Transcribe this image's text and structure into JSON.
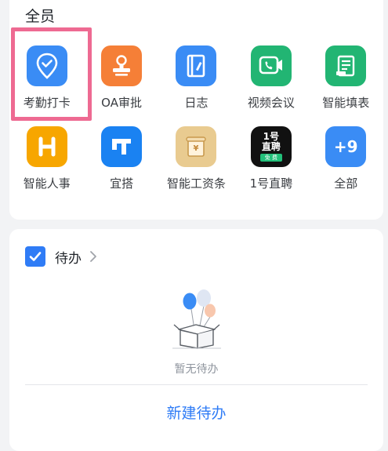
{
  "apps": {
    "section_title": "全员",
    "items": [
      {
        "label": "考勤打卡",
        "icon": "location-check-icon",
        "color": "#3a8cf5"
      },
      {
        "label": "OA审批",
        "icon": "stamp-icon",
        "color": "#f57f37"
      },
      {
        "label": "日志",
        "icon": "journal-pen-icon",
        "color": "#3a8cf5"
      },
      {
        "label": "视频会议",
        "icon": "video-call-icon",
        "color": "#22b573"
      },
      {
        "label": "智能填表",
        "icon": "form-icon",
        "color": "#22b573"
      },
      {
        "label": "智能人事",
        "icon": "hr-h-icon",
        "color": "#f7a600"
      },
      {
        "label": "宜搭",
        "icon": "yida-icon",
        "color": "#1a82f2"
      },
      {
        "label": "智能工资条",
        "icon": "payslip-icon",
        "color": "#e9cb90"
      },
      {
        "label": "1号直聘",
        "icon": "zhipin-icon",
        "color": "#111111",
        "icon_text_top": "1号",
        "icon_text_mid": "直聘",
        "icon_text_badge": "免 费"
      },
      {
        "label": "全部",
        "icon": "more-apps-icon",
        "color": "#3a8cf5",
        "icon_text": "+9"
      }
    ]
  },
  "todo": {
    "title": "待办",
    "empty_text": "暂无待办",
    "new_button": "新建待办"
  },
  "colors": {
    "accent": "#2f7cf6",
    "highlight_border": "#ee6a92",
    "background": "#f2f3f5"
  }
}
